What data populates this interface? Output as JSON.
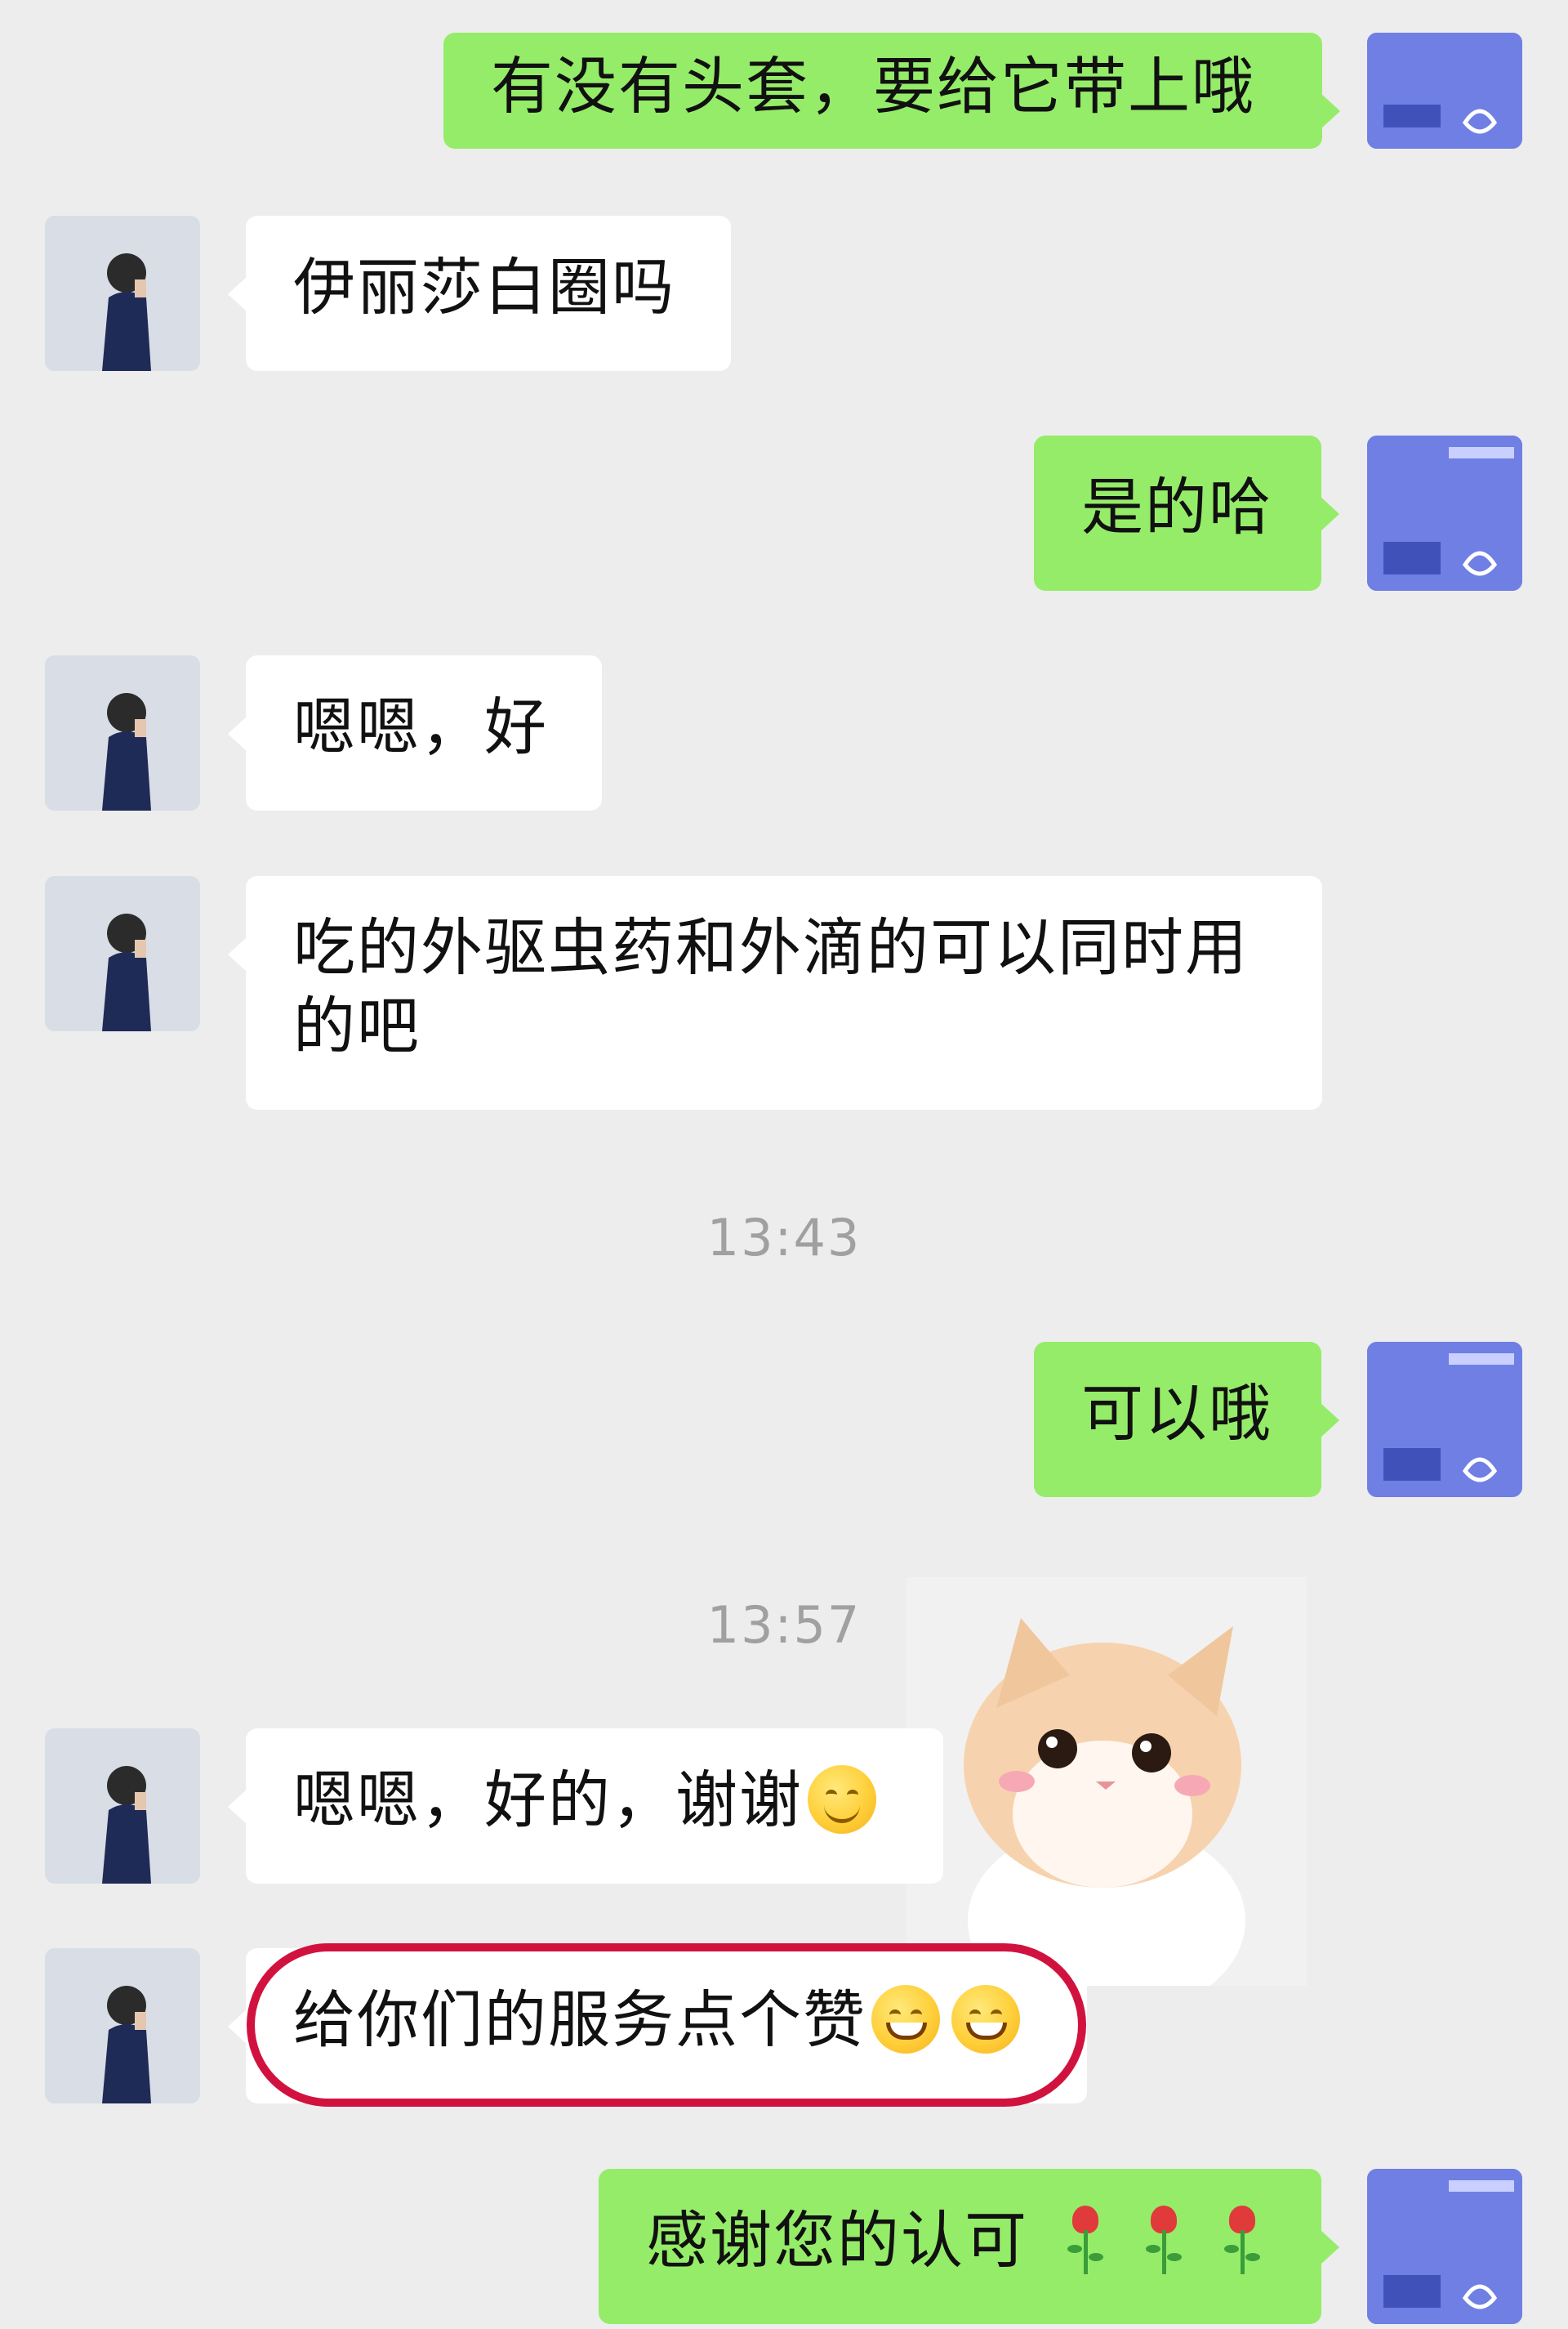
{
  "messages": [
    {
      "from": "shop",
      "text": "有没有头套，要给它带上哦"
    },
    {
      "from": "user",
      "text": "伊丽莎白圈吗"
    },
    {
      "from": "shop",
      "text": "是的哈"
    },
    {
      "from": "user",
      "text": "嗯嗯，好"
    },
    {
      "from": "user",
      "text_line1": "吃的外驱虫药和外滴的可以同时用",
      "text_line2": "的吧"
    },
    {
      "type": "timestamp",
      "text": "13:43"
    },
    {
      "from": "shop",
      "text": "可以哦"
    },
    {
      "type": "timestamp",
      "text": "13:57"
    },
    {
      "from": "user",
      "text": "嗯嗯，好的，谢谢",
      "emoji": "smiling-face-icon"
    },
    {
      "from": "user",
      "text": "给你们的服务点个赞",
      "emojis": [
        "grinning-face-icon",
        "grinning-face-icon"
      ]
    },
    {
      "from": "shop",
      "text": "感谢您的认可",
      "emojis": [
        "rose-icon",
        "rose-icon",
        "rose-icon"
      ]
    }
  ],
  "avatars": {
    "user": "person-avatar",
    "shop": "pet-hospital-logo-avatar"
  },
  "sticker": {
    "name": "cat-sticker"
  },
  "colors": {
    "background": "#ededed",
    "incoming_bubble": "#ffffff",
    "outgoing_bubble": "#95ec69",
    "highlight_ring": "#d1123f",
    "timestamp": "#a0a0a0"
  }
}
